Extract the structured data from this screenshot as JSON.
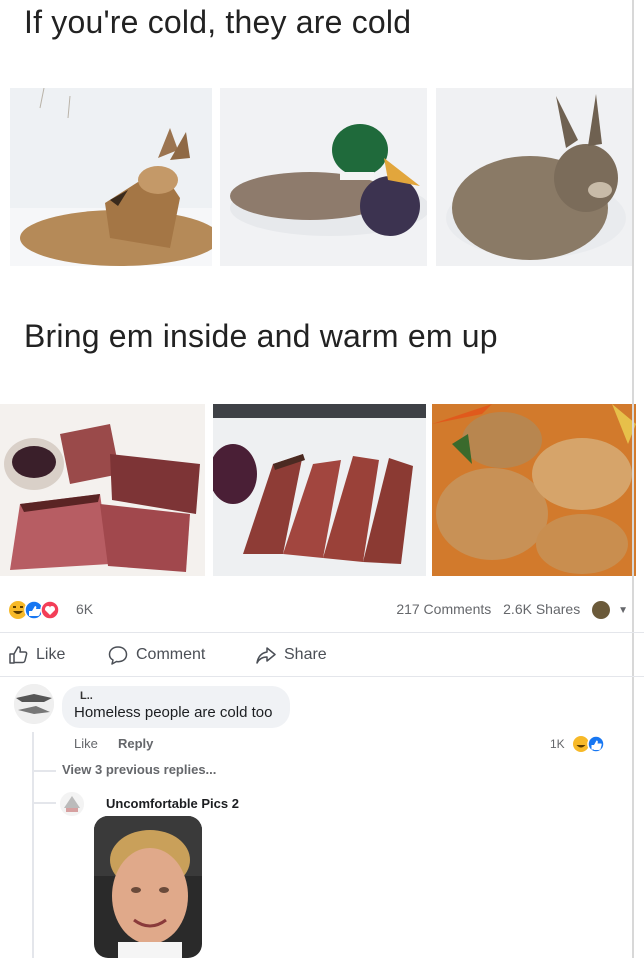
{
  "meme": {
    "caption_top": "If you're cold, they are cold",
    "caption_bottom": "Bring em inside and warm em up"
  },
  "post_stats": {
    "reaction_count": "6K",
    "comments": "217 Comments",
    "shares": "2.6K Shares"
  },
  "actions": {
    "like": "Like",
    "comment": "Comment",
    "share": "Share"
  },
  "comment": {
    "author": "L..",
    "text": "Homeless people are cold too",
    "like_label": "Like",
    "reply_label": "Reply",
    "reaction_count": "1K"
  },
  "thread": {
    "view_previous": "View 3 previous replies...",
    "reply_author": "Uncomfortable Pics 2"
  },
  "colors": {
    "link_gray": "#65676b",
    "bubble": "#f0f2f5",
    "like_blue": "#1877f2",
    "haha_yellow": "#f7b928",
    "love_red": "#f33e58"
  }
}
